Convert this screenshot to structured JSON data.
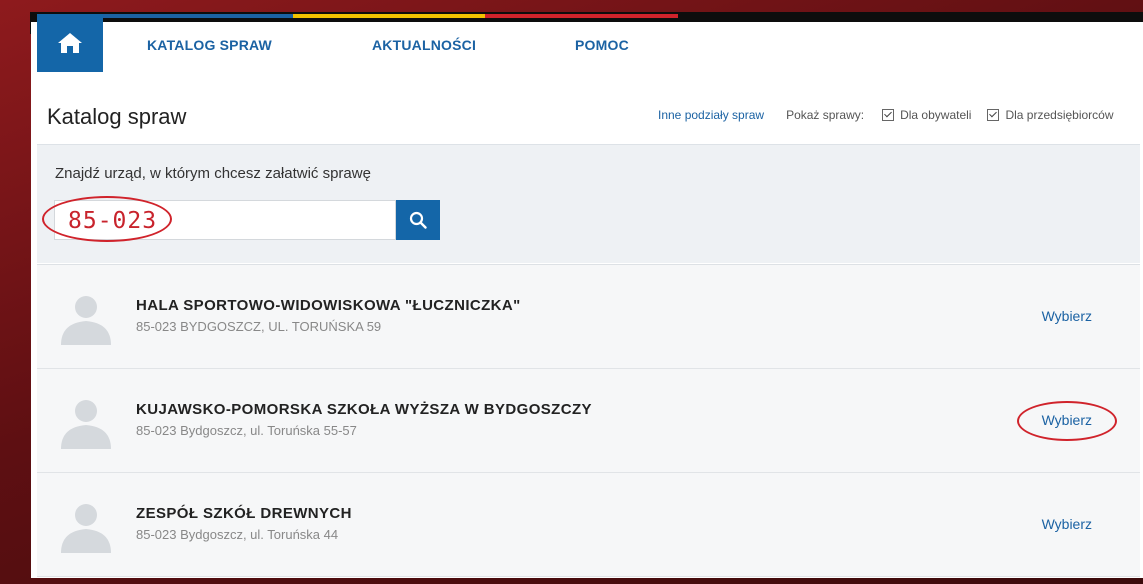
{
  "nav": {
    "items": [
      "KATALOG SPRAW",
      "AKTUALNOŚCI",
      "POMOC"
    ],
    "stripe_colors": [
      "#1b62a3",
      "#f2c200",
      "#d0232b"
    ],
    "home_icon": "home-icon"
  },
  "page": {
    "title": "Katalog spraw",
    "other_divisions_link": "Inne podziały spraw",
    "show_label": "Pokaż sprawy:",
    "filter_citizens": "Dla obywateli",
    "filter_business": "Dla przedsiębiorców"
  },
  "search": {
    "label": "Znajdź urząd, w którym chcesz załatwić sprawę",
    "value": "85-023",
    "button_icon": "search-icon"
  },
  "results": [
    {
      "name": "HALA SPORTOWO-WIDOWISKOWA \"ŁUCZNICZKA\"",
      "address": "85-023 BYDGOSZCZ, UL. TORUŃSKA 59",
      "action": "Wybierz"
    },
    {
      "name": "KUJAWSKO-POMORSKA SZKOŁA WYŻSZA W BYDGOSZCZY",
      "address": "85-023 Bydgoszcz, ul. Toruńska 55-57",
      "action": "Wybierz"
    },
    {
      "name": "ZESPÓŁ SZKÓŁ DREWNYCH",
      "address": "85-023 Bydgoszcz, ul. Toruńska 44",
      "action": "Wybierz"
    }
  ],
  "colors": {
    "accent": "#1466a8",
    "annotation": "#d0232b"
  }
}
